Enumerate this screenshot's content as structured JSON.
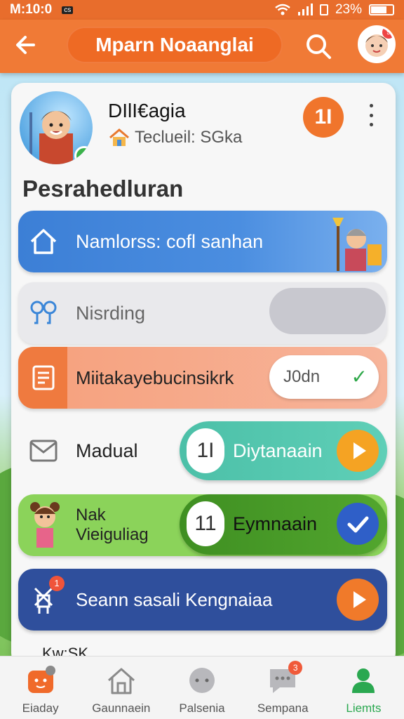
{
  "status_bar": {
    "time": "M:10:0",
    "sim": "cs",
    "battery": "23%"
  },
  "header": {
    "back_icon": "arrow-left-icon",
    "title": "Mparn Noaanglai",
    "search_icon": "search-icon",
    "avatar_badge": "9"
  },
  "profile": {
    "name": "DIlI€agia",
    "subtitle": "Teclueil: SGka",
    "action_label": "1I"
  },
  "section_title": "Pesrahedluran",
  "rows": {
    "home": {
      "label": "Namlorss: cofl sanhan"
    },
    "listening": {
      "label": "Nisrding"
    },
    "tasks": {
      "label": "Miitakayebucinsikrk",
      "chip": "J0dn"
    },
    "mail": {
      "label": "Madual",
      "pill_num": "1I",
      "pill_text": "Diytanaain"
    },
    "kid": {
      "label_line1": "Nak",
      "label_line2": "Vieiguliag",
      "pill_num": "11",
      "pill_text": "Eymnaain"
    },
    "search": {
      "label": "Seann sasali Kengnaiaa",
      "badge": "1"
    }
  },
  "partial_text": "Kw:SK",
  "bottom_nav": [
    {
      "label": "Eiaday",
      "icon": "home-robot-icon"
    },
    {
      "label": "Gaunnaein",
      "icon": "house-icon"
    },
    {
      "label": "Palsenia",
      "icon": "face-icon"
    },
    {
      "label": "Sempana",
      "icon": "chat-icon",
      "badge": "3"
    },
    {
      "label": "Liemts",
      "icon": "person-icon",
      "active": true
    }
  ],
  "colors": {
    "header": "#f07a36",
    "accent_green": "#2aa850",
    "row_blue": "#3c7fd6",
    "row_navy": "#2f4f9c"
  }
}
